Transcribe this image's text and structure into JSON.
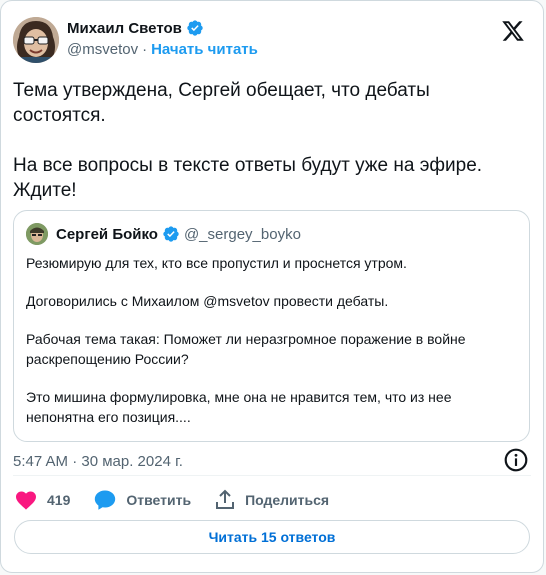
{
  "author": {
    "name": "Михаил Светов",
    "handle": "@msvetov",
    "separator": "·",
    "follow_label": "Начать читать"
  },
  "tweet": {
    "paragraphs": [
      "Тема утверждена, Сергей обещает, что дебаты состоятся.",
      "На все вопросы в тексте ответы будут уже на эфире. Ждите!"
    ]
  },
  "quote": {
    "name": "Сергей Бойко",
    "handle": "@_sergey_boyko",
    "paragraphs": [
      "Резюмирую для тех, кто все пропустил и проснется утром.",
      "Договорились с Михаилом @msvetov  провести дебаты.",
      "Рабочая тема такая: Поможет ли неразгромное поражение в войне раскрепощению России?",
      "Это мишина формулировка, мне она не нравится тем, что из нее непонятна его позиция...."
    ]
  },
  "meta": {
    "timestamp": "5:47 AM · 30 мар. 2024 г."
  },
  "actions": {
    "likes": "419",
    "reply_label": "Ответить",
    "share_label": "Поделиться"
  },
  "replies_button": "Читать 15 ответов",
  "colors": {
    "accent": "#1d9bf0",
    "like": "#f91880",
    "link_button": "#006fd6",
    "muted": "#536471"
  },
  "icons": [
    "verified-badge-icon",
    "x-logo-icon",
    "info-icon",
    "heart-icon",
    "reply-bubble-icon",
    "share-icon"
  ]
}
